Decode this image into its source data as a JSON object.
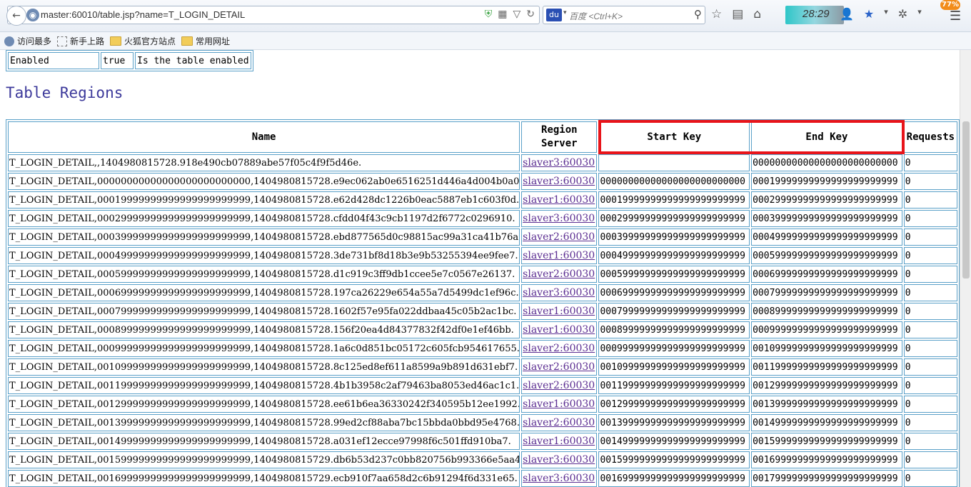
{
  "browser": {
    "url": "master:60010/table.jsp?name=T_LOGIN_DETAIL",
    "search_placeholder": "百度 <Ctrl+K>",
    "search_engine": "du",
    "clock": "28:29",
    "badge": "77%",
    "bookmarks": [
      "访问最多",
      "新手上路",
      "火狐官方站点",
      "常用网址"
    ]
  },
  "attr_row": {
    "name": "Enabled",
    "value": "true",
    "description": "Is the table enabled"
  },
  "section_title": "Table Regions",
  "table": {
    "headers": {
      "name": "Name",
      "region_server": "Region\nServer",
      "start_key": "Start Key",
      "end_key": "End Key",
      "requests": "Requests"
    },
    "rows": [
      {
        "name": "T_LOGIN_DETAIL,,1404980815728.918e490cb07889abe57f05c4f9f5d46e.",
        "server": "slaver3:60030",
        "start": "",
        "end": "00000000000000000000000000",
        "req": "0"
      },
      {
        "name": "T_LOGIN_DETAIL,00000000000000000000000000,1404980815728.e9ec062ab0e6516251d446a4d004b0a0.",
        "server": "slaver3:60030",
        "start": "00000000000000000000000000",
        "end": "00019999999999999999999999",
        "req": "0"
      },
      {
        "name": "T_LOGIN_DETAIL,00019999999999999999999999,1404980815728.e62d428dc1226b0eac5887eb1c603f0d.",
        "server": "slaver1:60030",
        "start": "00019999999999999999999999",
        "end": "00029999999999999999999999",
        "req": "0"
      },
      {
        "name": "T_LOGIN_DETAIL,00029999999999999999999999,1404980815728.cfdd04f43c9cb1197d2f6772c0296910.",
        "server": "slaver3:60030",
        "start": "00029999999999999999999999",
        "end": "00039999999999999999999999",
        "req": "0"
      },
      {
        "name": "T_LOGIN_DETAIL,00039999999999999999999999,1404980815728.ebd877565d0c98815ac99a31ca41b76a.",
        "server": "slaver2:60030",
        "start": "00039999999999999999999999",
        "end": "00049999999999999999999999",
        "req": "0"
      },
      {
        "name": "T_LOGIN_DETAIL,00049999999999999999999999,1404980815728.3de731bf8d18b3e9b53255394ee9fee7.",
        "server": "slaver1:60030",
        "start": "00049999999999999999999999",
        "end": "00059999999999999999999999",
        "req": "0"
      },
      {
        "name": "T_LOGIN_DETAIL,00059999999999999999999999,1404980815728.d1c919c3ff9db1ccee5e7c0567e26137.",
        "server": "slaver2:60030",
        "start": "00059999999999999999999999",
        "end": "00069999999999999999999999",
        "req": "0"
      },
      {
        "name": "T_LOGIN_DETAIL,00069999999999999999999999,1404980815728.197ca26229e654a55a7d5499dc1ef96c.",
        "server": "slaver3:60030",
        "start": "00069999999999999999999999",
        "end": "00079999999999999999999999",
        "req": "0"
      },
      {
        "name": "T_LOGIN_DETAIL,00079999999999999999999999,1404980815728.1602f57e95fa022ddbaa45c05b2ac1bc.",
        "server": "slaver1:60030",
        "start": "00079999999999999999999999",
        "end": "00089999999999999999999999",
        "req": "0"
      },
      {
        "name": "T_LOGIN_DETAIL,00089999999999999999999999,1404980815728.156f20ea4d84377832f42df0e1ef46bb.",
        "server": "slaver1:60030",
        "start": "00089999999999999999999999",
        "end": "00099999999999999999999999",
        "req": "0"
      },
      {
        "name": "T_LOGIN_DETAIL,00099999999999999999999999,1404980815728.1a6c0d851bc05172c605fcb954617655.",
        "server": "slaver2:60030",
        "start": "00099999999999999999999999",
        "end": "00109999999999999999999999",
        "req": "0"
      },
      {
        "name": "T_LOGIN_DETAIL,00109999999999999999999999,1404980815728.8c125ed8ef611a8599a9b891d631ebf7.",
        "server": "slaver2:60030",
        "start": "00109999999999999999999999",
        "end": "00119999999999999999999999",
        "req": "0"
      },
      {
        "name": "T_LOGIN_DETAIL,00119999999999999999999999,1404980815728.4b1b3958c2af79463ba8053ed46ac1c1.",
        "server": "slaver2:60030",
        "start": "00119999999999999999999999",
        "end": "00129999999999999999999999",
        "req": "0"
      },
      {
        "name": "T_LOGIN_DETAIL,00129999999999999999999999,1404980815728.ee61b6ea36330242f340595b12ee1992.",
        "server": "slaver1:60030",
        "start": "00129999999999999999999999",
        "end": "00139999999999999999999999",
        "req": "0"
      },
      {
        "name": "T_LOGIN_DETAIL,00139999999999999999999999,1404980815728.99ed2cf88aba7bc15bbda0bbd95e4768.",
        "server": "slaver2:60030",
        "start": "00139999999999999999999999",
        "end": "00149999999999999999999999",
        "req": "0"
      },
      {
        "name": "T_LOGIN_DETAIL,00149999999999999999999999,1404980815728.a031ef12ecce97998f6c501ffd910ba7.",
        "server": "slaver1:60030",
        "start": "00149999999999999999999999",
        "end": "00159999999999999999999999",
        "req": "0"
      },
      {
        "name": "T_LOGIN_DETAIL,00159999999999999999999999,1404980815729.db6b53d237c0bb820756b993366e5aa4.",
        "server": "slaver3:60030",
        "start": "00159999999999999999999999",
        "end": "00169999999999999999999999",
        "req": "0"
      },
      {
        "name": "T_LOGIN_DETAIL,00169999999999999999999999,1404980815729.ecb910f7aa658d2c6b91294f6d331e65.",
        "server": "slaver3:60030",
        "start": "00169999999999999999999999",
        "end": "00179999999999999999999999",
        "req": "0"
      }
    ]
  },
  "colors": {
    "highlight": "#e8141a",
    "table_border": "#5aa0c8",
    "section_title": "#3d3a9b",
    "link": "#5b2d91"
  }
}
